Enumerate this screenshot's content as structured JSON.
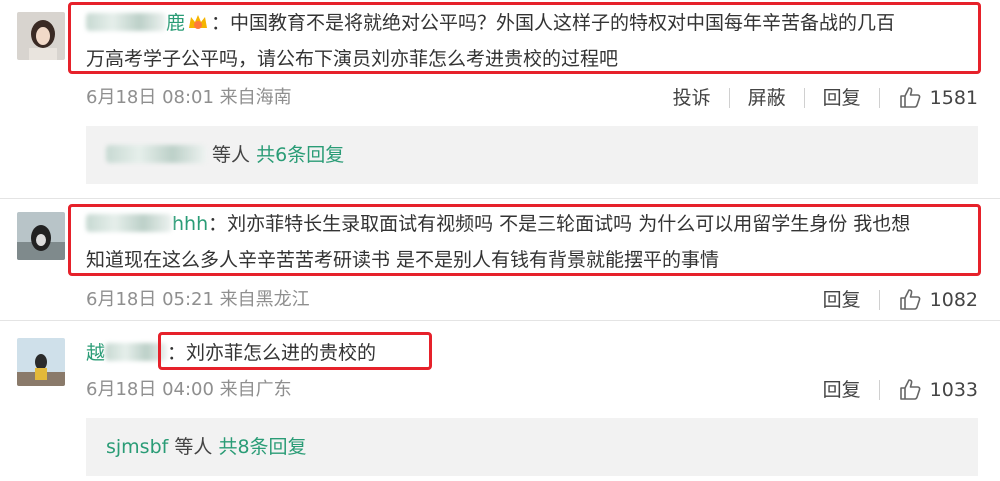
{
  "comments": [
    {
      "user_visible": "鹿",
      "text_line1": "：中国教育不是将就绝对公平吗？外国人这样子的特权对中国每年辛苦备战的几百",
      "text_line2": "万高考学子公平吗，请公布下演员刘亦菲怎么考进贵校的过程吧",
      "meta": "6月18日 08:01 来自海南",
      "report": "投诉",
      "block": "屏蔽",
      "reply": "回复",
      "likes": "1581",
      "reply_box": {
        "users": "等人",
        "count": "共6条回复"
      }
    },
    {
      "user_visible": "hhh",
      "text_line1": "：刘亦菲特长生录取面试有视频吗 不是三轮面试吗 为什么可以用留学生身份 我也想",
      "text_line2": "知道现在这么多人辛辛苦苦考研读书 是不是别人有钱有背景就能摆平的事情",
      "meta": "6月18日 05:21 来自黑龙江",
      "reply": "回复",
      "likes": "1082"
    },
    {
      "user_visible": "越",
      "text_line1": "：刘亦菲怎么进的贵校的",
      "meta": "6月18日 04:00 来自广东",
      "reply": "回复",
      "likes": "1033",
      "reply_box": {
        "user": "sjmsbf",
        "users": "等人",
        "count": "共8条回复"
      }
    }
  ],
  "colors": {
    "username": "#2a9c76",
    "highlight": "#e6212a",
    "reply_bg": "#f2f2f2"
  }
}
